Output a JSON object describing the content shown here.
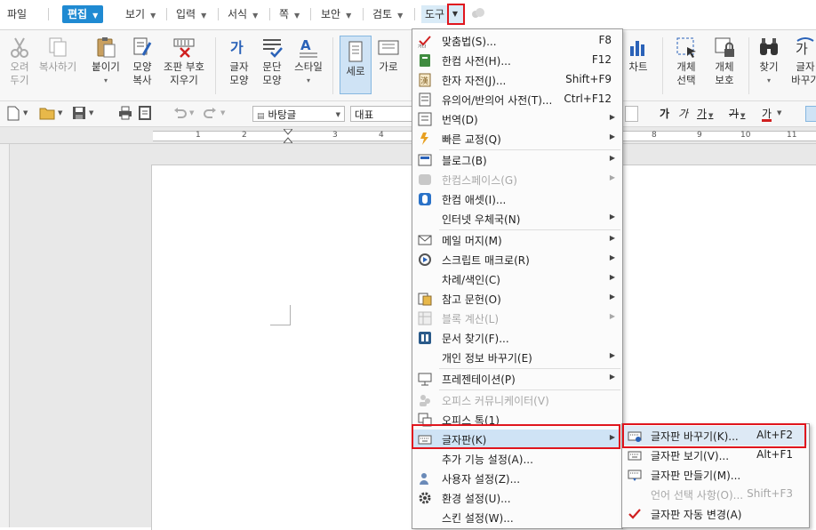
{
  "menubar": {
    "items": [
      {
        "label": "파일"
      },
      {
        "label": "편집"
      },
      {
        "label": "보기"
      },
      {
        "label": "입력"
      },
      {
        "label": "서식"
      },
      {
        "label": "쪽"
      },
      {
        "label": "보안"
      },
      {
        "label": "검토"
      },
      {
        "label": "도구"
      }
    ]
  },
  "ribbon": {
    "buttons": [
      {
        "label": "오려\n두기",
        "icon": "scissors-icon",
        "enabled": false
      },
      {
        "label": "복사하기",
        "icon": "copy-icon",
        "enabled": false
      },
      {
        "label": "붙이기",
        "icon": "paste-icon",
        "enabled": true
      },
      {
        "label": "모양\n복사",
        "icon": "format-painter-icon",
        "enabled": true
      },
      {
        "label": "조판 부호\n지우기",
        "icon": "clear-markup-icon",
        "enabled": true
      },
      {
        "label": "글자\n모양",
        "icon": "char-shape-icon",
        "enabled": true
      },
      {
        "label": "문단\n모양",
        "icon": "para-shape-icon",
        "enabled": true
      },
      {
        "label": "스타일",
        "icon": "style-icon",
        "enabled": true
      },
      {
        "label": "세로",
        "icon": "portrait-icon",
        "enabled": true
      },
      {
        "label": "가로",
        "icon": "landscape-icon",
        "enabled": true
      },
      {
        "label": "차트",
        "icon": "chart-icon",
        "enabled": true
      },
      {
        "label": "개체\n선택",
        "icon": "object-select-icon",
        "enabled": true
      },
      {
        "label": "개체\n보호",
        "icon": "object-protect-icon",
        "enabled": true
      },
      {
        "label": "찾기",
        "icon": "binoculars-icon",
        "enabled": true
      },
      {
        "label": "글자\n바꾸기",
        "icon": "replace-char-icon",
        "enabled": true
      }
    ]
  },
  "toolbar": {
    "style_value": "바탕글",
    "font_value": "대표",
    "char_buttons": [
      "가",
      "가",
      "가",
      "가",
      "가"
    ]
  },
  "ruler": {
    "ticks": [
      "1",
      "2",
      "3",
      "4",
      "8",
      "9",
      "10",
      "11"
    ]
  },
  "tools_menu": {
    "items": [
      {
        "label": "맞춤법(S)...",
        "shortcut": "F8",
        "icon": "spellcheck-icon",
        "enabled": true,
        "submenu": false
      },
      {
        "label": "한컴 사전(H)...",
        "shortcut": "F12",
        "icon": "dictionary-icon",
        "enabled": true,
        "submenu": false
      },
      {
        "label": "한자 자전(J)...",
        "shortcut": "Shift+F9",
        "icon": "hanja-icon",
        "enabled": true,
        "submenu": false
      },
      {
        "label": "유의어/반의어 사전(T)...",
        "shortcut": "Ctrl+F12",
        "icon": "thesaurus-icon",
        "enabled": true,
        "submenu": false
      },
      {
        "label": "번역(D)",
        "shortcut": "",
        "icon": "translate-icon",
        "enabled": true,
        "submenu": true
      },
      {
        "label": "빠른 교정(Q)",
        "shortcut": "",
        "icon": "quick-correct-icon",
        "enabled": true,
        "submenu": true
      },
      {
        "label": "블로그(B)",
        "shortcut": "",
        "icon": "blog-icon",
        "enabled": true,
        "submenu": true
      },
      {
        "label": "한컴스페이스(G)",
        "shortcut": "",
        "icon": "hancom-space-icon",
        "enabled": false,
        "submenu": true
      },
      {
        "label": "한컴 애셋(I)...",
        "shortcut": "",
        "icon": "hancom-asset-icon",
        "enabled": true,
        "submenu": false
      },
      {
        "label": "인터넷 우체국(N)",
        "shortcut": "",
        "icon": "",
        "enabled": true,
        "submenu": true
      },
      {
        "label": "메일 머지(M)",
        "shortcut": "",
        "icon": "mail-merge-icon",
        "enabled": true,
        "submenu": true
      },
      {
        "label": "스크립트 매크로(R)",
        "shortcut": "",
        "icon": "script-macro-icon",
        "enabled": true,
        "submenu": true
      },
      {
        "label": "차례/색인(C)",
        "shortcut": "",
        "icon": "",
        "enabled": true,
        "submenu": true
      },
      {
        "label": "참고 문헌(O)",
        "shortcut": "",
        "icon": "bibliography-icon",
        "enabled": true,
        "submenu": true
      },
      {
        "label": "블록 계산(L)",
        "shortcut": "",
        "icon": "block-calc-icon",
        "enabled": false,
        "submenu": true
      },
      {
        "label": "문서 찾기(F)...",
        "shortcut": "",
        "icon": "find-document-icon",
        "enabled": true,
        "submenu": false
      },
      {
        "label": "개인 정보 바꾸기(E)",
        "shortcut": "",
        "icon": "",
        "enabled": true,
        "submenu": true
      },
      {
        "label": "프레젠테이션(P)",
        "shortcut": "",
        "icon": "presentation-icon",
        "enabled": true,
        "submenu": true
      },
      {
        "label": "오피스 커뮤니케이터(V)",
        "shortcut": "",
        "icon": "office-communicator-icon",
        "enabled": false,
        "submenu": false
      },
      {
        "label": "오피스 톡(1)",
        "shortcut": "",
        "icon": "office-talk-icon",
        "enabled": true,
        "submenu": false
      },
      {
        "label": "글자판(K)",
        "shortcut": "",
        "icon": "keyboard-icon",
        "enabled": true,
        "submenu": true
      },
      {
        "label": "추가 기능 설정(A)...",
        "shortcut": "",
        "icon": "",
        "enabled": true,
        "submenu": false
      },
      {
        "label": "사용자 설정(Z)...",
        "shortcut": "",
        "icon": "user-settings-icon",
        "enabled": true,
        "submenu": false
      },
      {
        "label": "환경 설정(U)...",
        "shortcut": "",
        "icon": "gear-icon",
        "enabled": true,
        "submenu": false
      },
      {
        "label": "스킨 설정(W)...",
        "shortcut": "",
        "icon": "",
        "enabled": true,
        "submenu": false
      }
    ]
  },
  "keyboard_submenu": {
    "items": [
      {
        "label": "글자판 바꾸기(K)...",
        "shortcut": "Alt+F2",
        "icon": "keyboard-switch-icon",
        "enabled": true
      },
      {
        "label": "글자판 보기(V)...",
        "shortcut": "Alt+F1",
        "icon": "keyboard-view-icon",
        "enabled": true
      },
      {
        "label": "글자판 만들기(M)...",
        "shortcut": "",
        "icon": "keyboard-create-icon",
        "enabled": true
      },
      {
        "label": "언어 선택 사항(O)...",
        "shortcut": "Shift+F3",
        "icon": "",
        "enabled": false
      },
      {
        "label": "글자판 자동 변경(A)",
        "shortcut": "",
        "icon": "checkmark-icon",
        "enabled": true
      }
    ]
  },
  "colors": {
    "accent": "#1f8ad2",
    "highlight_box": "#e0161e",
    "menu_hover": "#cfe3f5"
  }
}
